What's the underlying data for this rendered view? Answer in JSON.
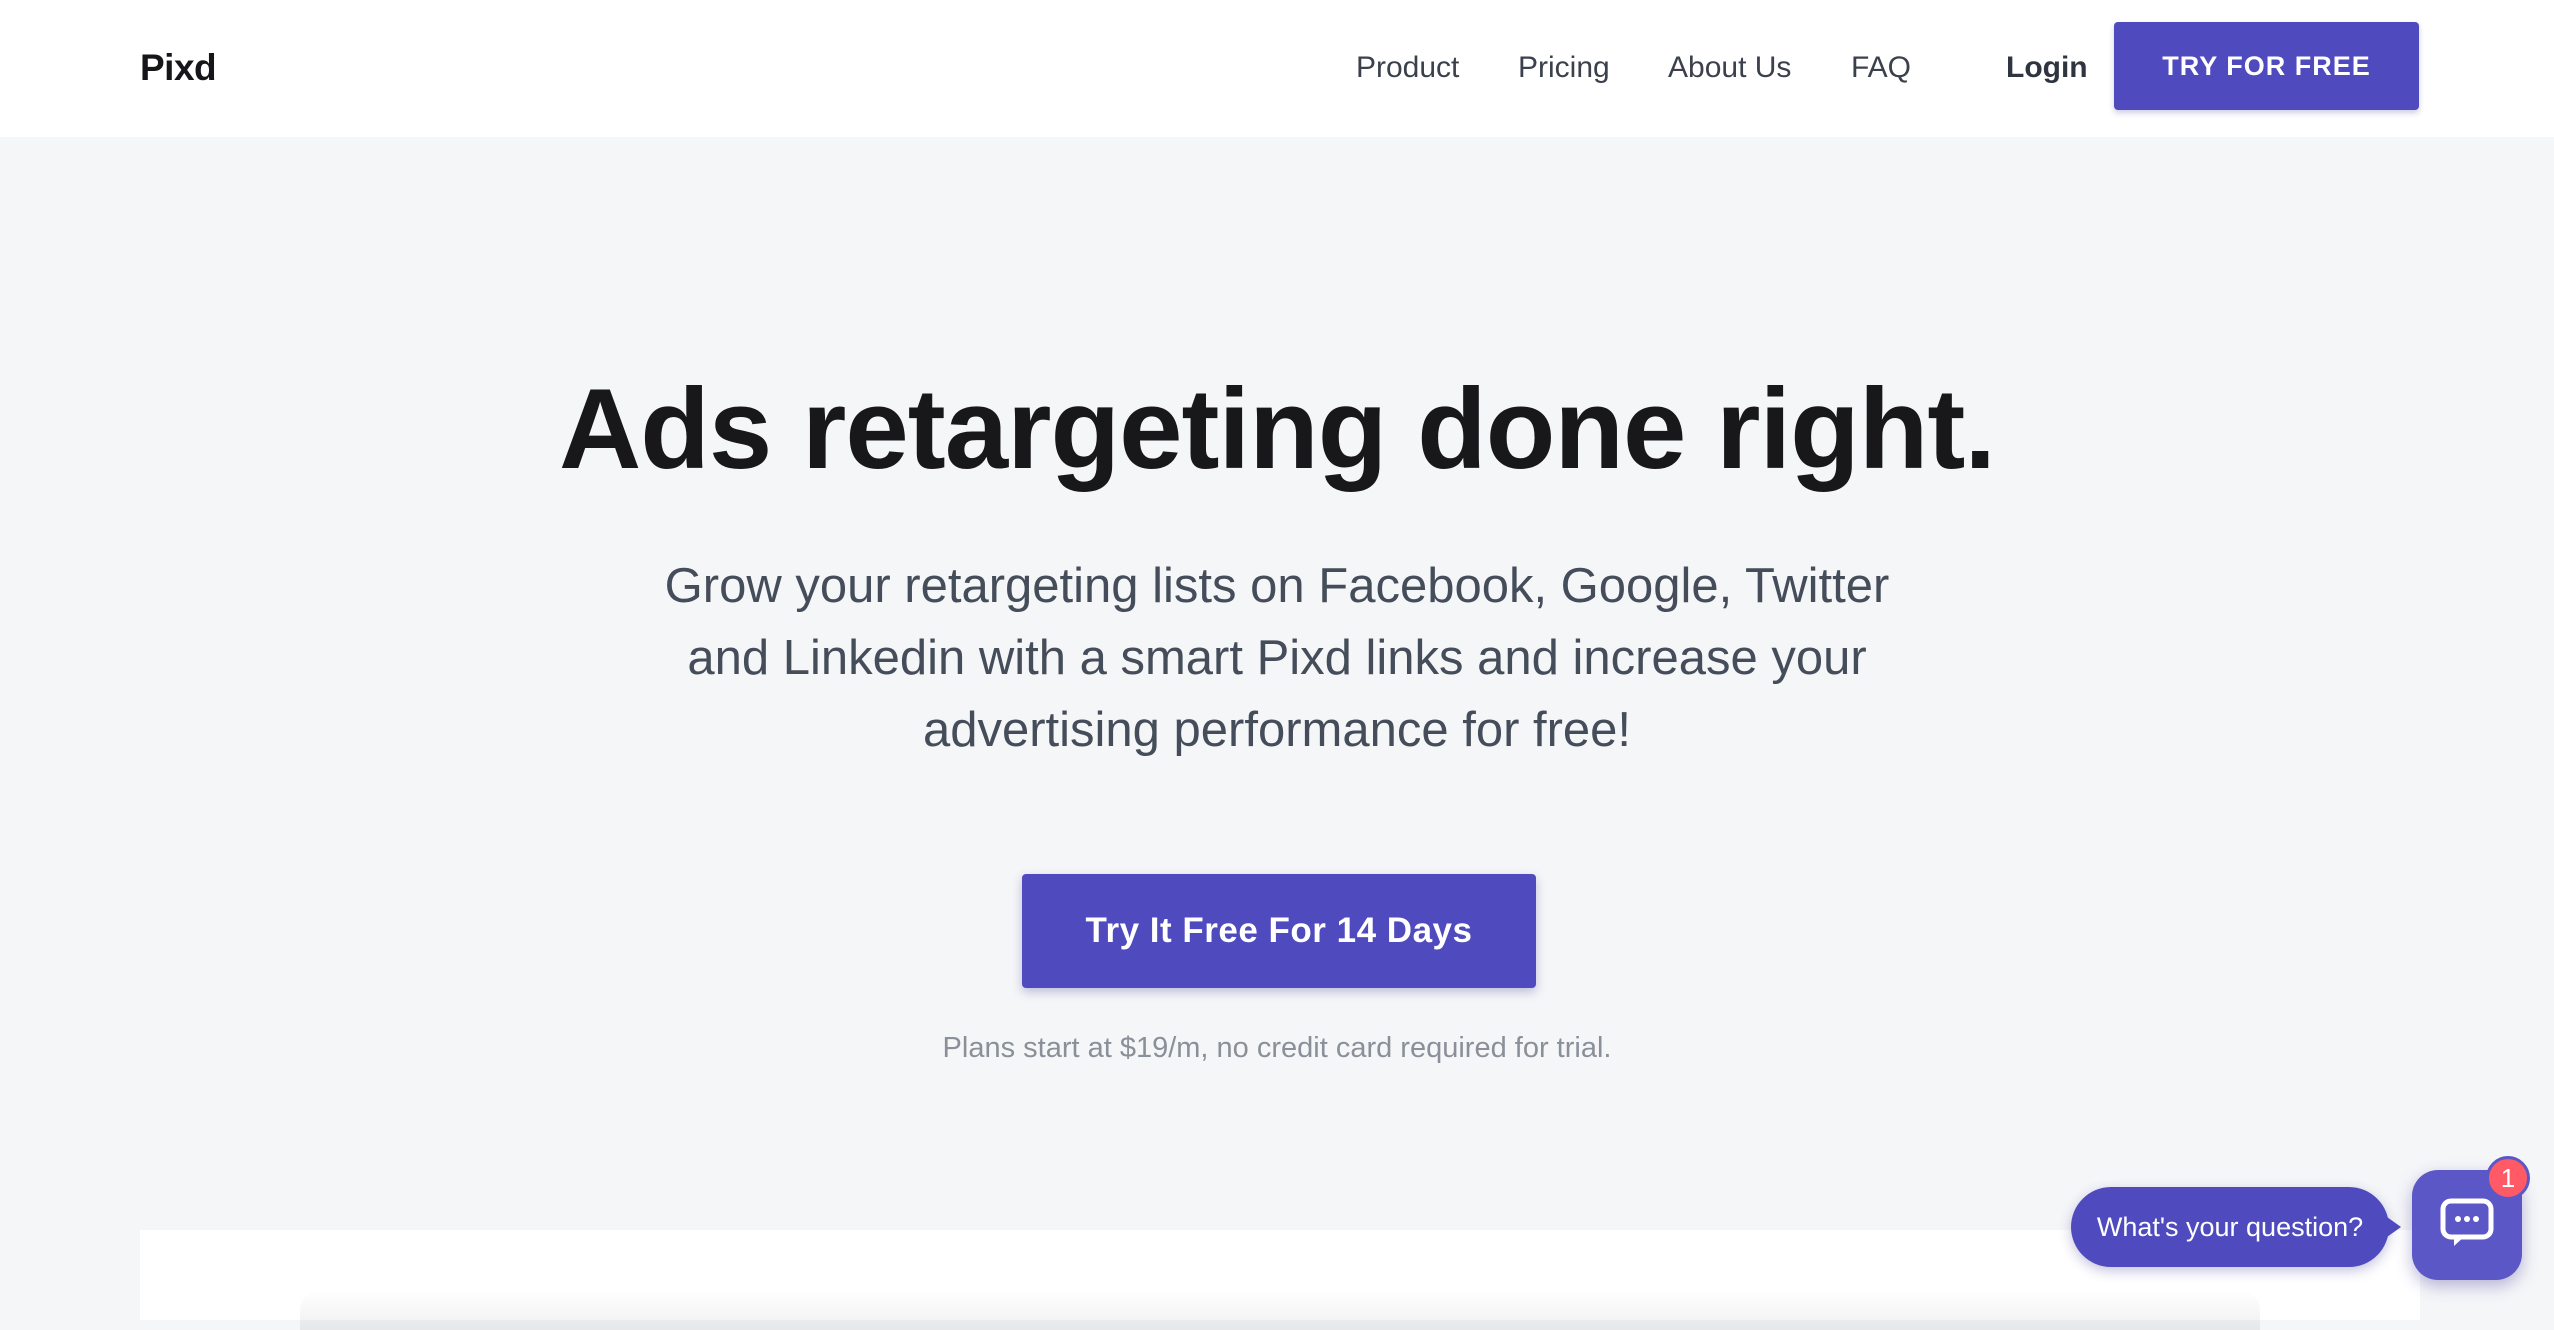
{
  "header": {
    "logo": "Pixd",
    "nav": {
      "product": "Product",
      "pricing": "Pricing",
      "about": "About Us",
      "faq": "FAQ",
      "login": "Login"
    },
    "cta_label": "TRY FOR FREE"
  },
  "hero": {
    "title": "Ads retargeting done right.",
    "subtitle_lines": [
      "Grow your retargeting lists on Facebook, Google, Twitter",
      "and Linkedin with a smart Pixd links and increase your",
      "advertising performance for free!"
    ],
    "cta_label": "Try It Free For 14 Days",
    "note": "Plans start at $19/m, no credit card required for trial."
  },
  "chat": {
    "prompt": "What's your question?",
    "badge_count": "1",
    "launcher_icon": "chat-bubble-icon"
  },
  "colors": {
    "brand": "#4f4bbf",
    "background": "#f5f6f8",
    "badge": "#ff5a66"
  }
}
